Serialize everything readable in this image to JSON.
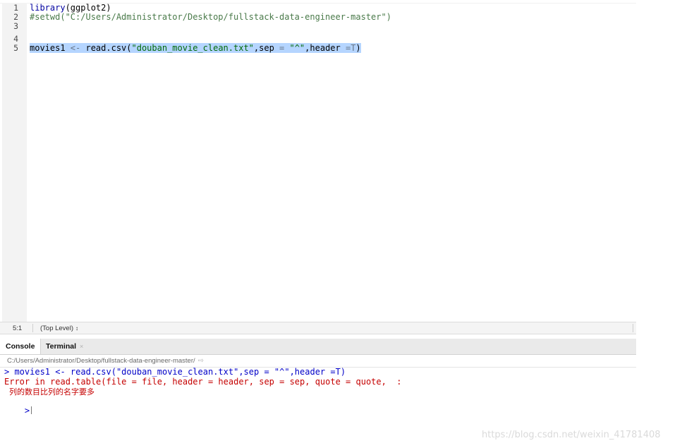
{
  "editor": {
    "lines": [
      {
        "n": "1",
        "tokens": [
          {
            "t": "library",
            "c": "fn"
          },
          {
            "t": "(ggplot2)",
            "c": "plain"
          }
        ]
      },
      {
        "n": "2",
        "tokens": [
          {
            "t": "#setwd(\"C:/Users/Administrator/Desktop/fullstack-data-engineer-master\")",
            "c": "comment"
          }
        ]
      },
      {
        "n": "3",
        "tokens": []
      },
      {
        "n": "4",
        "tokens": []
      },
      {
        "n": "5",
        "tokens": [
          {
            "t": "movies1 ",
            "c": "plain"
          },
          {
            "t": "<-",
            "c": "op"
          },
          {
            "t": " read.csv(",
            "c": "plain"
          },
          {
            "t": "\"douban_movie_clean.txt\"",
            "c": "string"
          },
          {
            "t": ",sep ",
            "c": "plain"
          },
          {
            "t": "=",
            "c": "op"
          },
          {
            "t": " ",
            "c": "plain"
          },
          {
            "t": "\"^\"",
            "c": "string"
          },
          {
            "t": ",header ",
            "c": "plain"
          },
          {
            "t": "=T",
            "c": "op"
          },
          {
            "t": ")",
            "c": "plain"
          }
        ]
      }
    ]
  },
  "statusbar": {
    "position": "5:1",
    "scope": "(Top Level)",
    "scope_caret": "↕"
  },
  "console": {
    "tabs": {
      "console_label": "Console",
      "terminal_label": "Terminal",
      "terminal_close": "×"
    },
    "path": "C:/Users/Administrator/Desktop/fullstack-data-engineer-master/",
    "path_go_icon": "⇨",
    "command": "> movies1 <- read.csv(\"douban_movie_clean.txt\",sep = \"^\",header =T)",
    "error_line": "Error in read.table(file = file, header = header, sep = sep, quote = quote,  :",
    "error_message": "  列的数目比列的名字要多",
    "prompt": ">"
  },
  "watermark": "https://blog.csdn.net/weixin_41781408",
  "colors": {
    "selection": "#b5d5ff",
    "error": "#c50000",
    "command": "#0000c8",
    "string": "#036a07",
    "function": "#0000a0"
  }
}
